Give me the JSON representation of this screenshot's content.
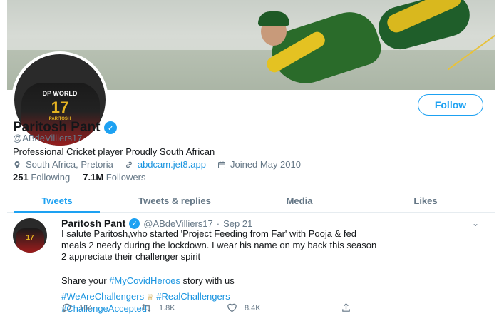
{
  "profile": {
    "display_name": "Paritosh Pant",
    "handle": "@ABdeVilliers17",
    "bio": "Professional Cricket player Proudly South African",
    "location": "South Africa, Pretoria",
    "website": "abdcam.jet8.app",
    "joined": "Joined May 2010",
    "following_count": "251",
    "following_label": "Following",
    "followers_count": "7.1M",
    "followers_label": "Followers",
    "follow_button": "Follow",
    "avatar_jersey_sponsor": "DP WORLD",
    "avatar_jersey_number": "17",
    "avatar_jersey_name": "PARITOSH"
  },
  "tabs": [
    {
      "label": "Tweets",
      "active": true
    },
    {
      "label": "Tweets & replies",
      "active": false
    },
    {
      "label": "Media",
      "active": false
    },
    {
      "label": "Likes",
      "active": false
    }
  ],
  "tweet": {
    "name": "Paritosh Pant",
    "handle": "@ABdeVilliers17",
    "separator": "·",
    "date": "Sep 21",
    "line1": "I salute Paritosh,who started 'Project Feeding from Far' with Pooja & fed",
    "line2": "meals 2 needy during the lockdown. I wear his name on my back this season",
    "line3": "2 appreciate their challenger spirit",
    "share_pre": "Share your ",
    "share_tag": "#MyCovidHeroes",
    "share_post": " story with us",
    "tag1": "#WeAreChallengers",
    "tag2": "#RealChallengers",
    "tag3": "#ChallengeAccepted",
    "replies": "164",
    "retweets": "1.8K",
    "likes": "8.4K",
    "avatar_number": "17"
  },
  "colors": {
    "accent": "#1da1f2",
    "link": "#1b95e0",
    "muted": "#657786"
  }
}
